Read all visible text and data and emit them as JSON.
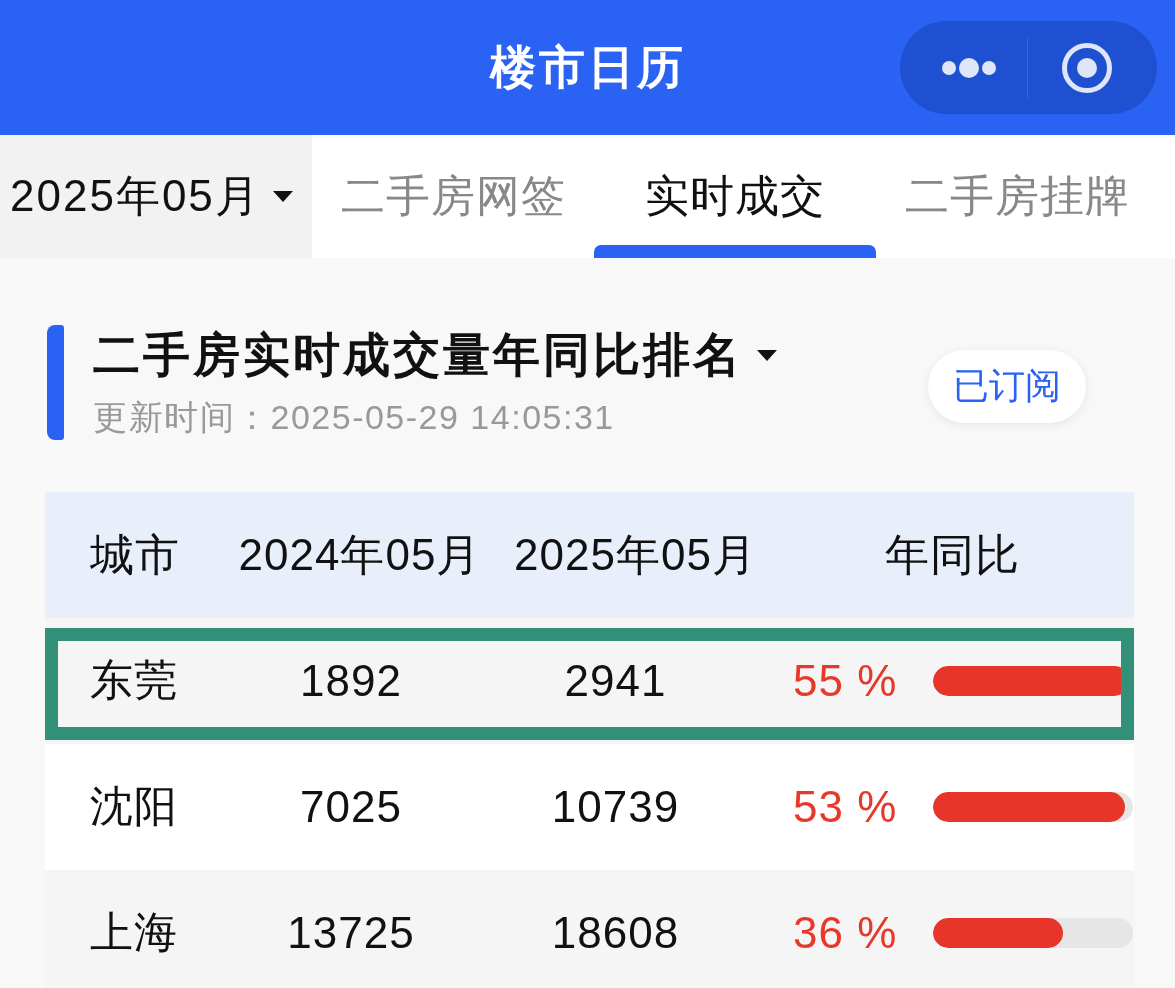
{
  "header": {
    "title": "楼市日历"
  },
  "tabs_bar": {
    "month": "2025年05月",
    "tabs": [
      {
        "label": "二手房网签",
        "selected": false
      },
      {
        "label": "实时成交",
        "selected": true
      },
      {
        "label": "二手房挂牌",
        "selected": false
      }
    ]
  },
  "section": {
    "title": "二手房实时成交量年同比排名",
    "updated": "更新时间：2025-05-29 14:05:31",
    "subscribe": "已订阅"
  },
  "table": {
    "columns": [
      "城市",
      "2024年05月",
      "2025年05月",
      "年同比"
    ],
    "rows": [
      {
        "city": "东莞",
        "prev": "1892",
        "curr": "2941",
        "yoy": "55 %",
        "level": 0.98,
        "highlighted": true
      },
      {
        "city": "沈阳",
        "prev": "7025",
        "curr": "10739",
        "yoy": "53 %",
        "level": 0.96,
        "highlighted": false
      },
      {
        "city": "上海",
        "prev": "13725",
        "curr": "18608",
        "yoy": "36 %",
        "level": 0.65,
        "highlighted": false
      }
    ]
  }
}
